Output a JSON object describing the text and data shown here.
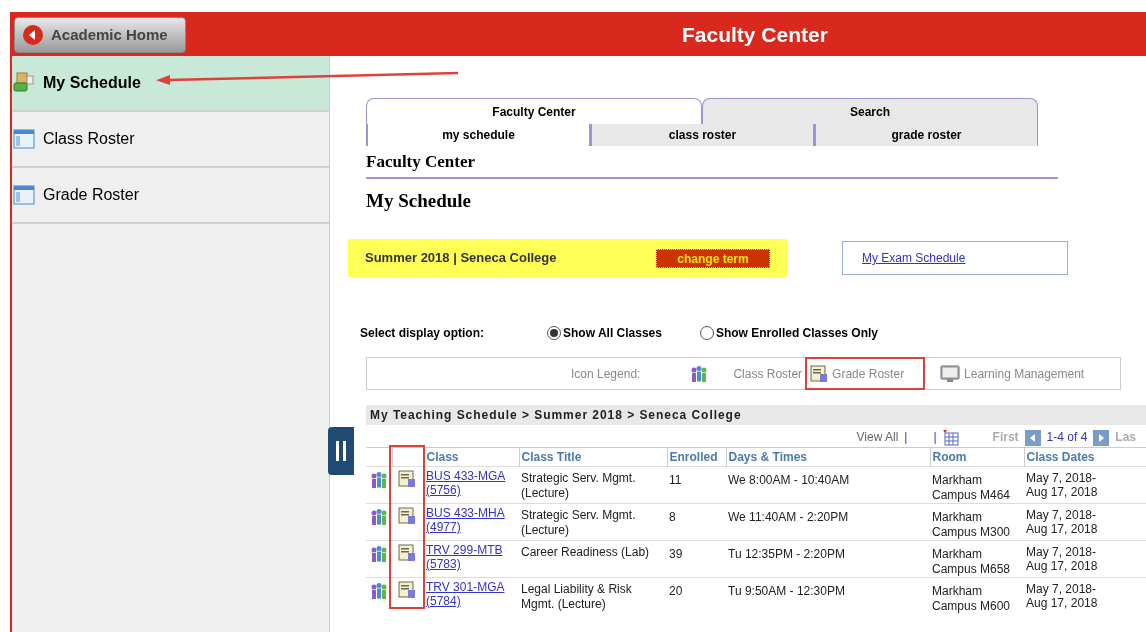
{
  "header": {
    "back_button": "Academic Home",
    "title": "Faculty Center"
  },
  "sidebar": {
    "items": [
      {
        "label": "My Schedule",
        "selected": true,
        "kind": "schedule"
      },
      {
        "label": "Class Roster",
        "selected": false,
        "kind": "roster"
      },
      {
        "label": "Grade Roster",
        "selected": false,
        "kind": "roster"
      }
    ]
  },
  "tabs": [
    {
      "label": "Faculty Center",
      "selected": true
    },
    {
      "label": "Search",
      "selected": false
    }
  ],
  "subtabs": [
    {
      "label": "my schedule",
      "selected": true
    },
    {
      "label": "class roster",
      "selected": false
    },
    {
      "label": "grade roster",
      "selected": false
    }
  ],
  "page_title": "Faculty Center",
  "section_title": "My Schedule",
  "term": {
    "label": "Summer 2018 | Seneca College",
    "button": "change term"
  },
  "exam_link": "My Exam Schedule",
  "display_option": {
    "label": "Select display option:",
    "options": [
      {
        "label": "Show All Classes",
        "selected": true
      },
      {
        "label": "Show Enrolled Classes Only",
        "selected": false
      }
    ]
  },
  "legend": {
    "label": "Icon Legend:",
    "items": [
      {
        "kind": "class_roster",
        "label": "Class Roster",
        "highlighted": false
      },
      {
        "kind": "grade_roster",
        "label": "Grade Roster",
        "highlighted": true
      },
      {
        "kind": "learning",
        "label": "Learning Management",
        "highlighted": false
      }
    ]
  },
  "schedule": {
    "breadcrumb": "My Teaching Schedule > Summer 2018 > Seneca College",
    "nav": {
      "view_all": "View All",
      "separator_1": "|",
      "separator_2": "|",
      "first": "First",
      "range": "1-4 of 4",
      "last": "Las"
    },
    "columns": [
      "Class",
      "Class Title",
      "Enrolled",
      "Days & Times",
      "Room",
      "Class Dates"
    ],
    "rows": [
      {
        "class": "BUS 433-MGA (5756)",
        "title": "Strategic Serv. Mgmt. (Lecture)",
        "enrolled": "11",
        "times": "We 8:00AM - 10:40AM",
        "room": "Markham Campus M464",
        "dates": "May 7, 2018- Aug 17, 2018"
      },
      {
        "class": "BUS 433-MHA (4977)",
        "title": "Strategic Serv. Mgmt. (Lecture)",
        "enrolled": "8",
        "times": "We 11:40AM - 2:20PM",
        "room": "Markham Campus M300",
        "dates": "May 7, 2018- Aug 17, 2018"
      },
      {
        "class": "TRV 299-MTB (5783)",
        "title": "Career Readiness (Lab)",
        "enrolled": "39",
        "times": "Tu 12:35PM - 2:20PM",
        "room": "Markham Campus M658",
        "dates": "May 7, 2018- Aug 17, 2018"
      },
      {
        "class": "TRV 301-MGA (5784)",
        "title": "Legal Liability & Risk Mgmt. (Lecture)",
        "enrolled": "20",
        "times": "Tu 9:50AM - 12:30PM",
        "room": "Markham Campus M600",
        "dates": "May 7, 2018- Aug 17, 2018"
      }
    ],
    "icon_column_highlighted": true
  }
}
